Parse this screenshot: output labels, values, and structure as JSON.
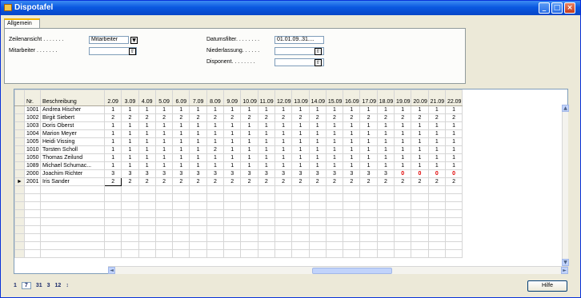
{
  "window": {
    "title": "Dispotafel",
    "controls": {
      "minimize": "_",
      "maximize": "□",
      "close": "×"
    }
  },
  "tabs": [
    {
      "label": "Allgemein"
    }
  ],
  "filters": {
    "zeilenansicht": {
      "label": "Zeilenansicht . . . . . . .",
      "value": "Mitarbeiter"
    },
    "mitarbeiter": {
      "label": "Mitarbeiter . . . . . . .",
      "value": ""
    },
    "datumsfilter": {
      "label": "Datumsfilter. . . . . . . .",
      "value": "01.01.09..31...."
    },
    "niederlassung": {
      "label": "Niederlassung. . . . . .",
      "value": ""
    },
    "disponent": {
      "label": "Disponent. . . . . . . .",
      "value": ""
    }
  },
  "grid": {
    "headers": {
      "nr": "Nr.",
      "beschreibung": "Beschreibung"
    },
    "days": [
      "2.09",
      "3.09",
      "4.09",
      "5.09",
      "6.09",
      "7.09",
      "8.09",
      "9.09",
      "10.09",
      "11.09",
      "12.09",
      "13.09",
      "14.09",
      "15.09",
      "16.09",
      "17.09",
      "18.09",
      "19.09",
      "20.09",
      "21.09",
      "22.09"
    ],
    "current_row_marker": "►",
    "rows": [
      {
        "nr": "1001",
        "name": "Andrea Hischer",
        "values": [
          "1",
          "1",
          "1",
          "1",
          "1",
          "1",
          "1",
          "1",
          "1",
          "1",
          "1",
          "1",
          "1",
          "1",
          "1",
          "1",
          "1",
          "1",
          "1",
          "1",
          "1"
        ]
      },
      {
        "nr": "1002",
        "name": "Birgit Siebert",
        "values": [
          "2",
          "2",
          "2",
          "2",
          "2",
          "2",
          "2",
          "2",
          "2",
          "2",
          "2",
          "2",
          "2",
          "2",
          "2",
          "2",
          "2",
          "2",
          "2",
          "2",
          "2"
        ]
      },
      {
        "nr": "1003",
        "name": "Doris Oberst",
        "values": [
          "1",
          "1",
          "1",
          "1",
          "1",
          "1",
          "1",
          "1",
          "1",
          "1",
          "1",
          "1",
          "1",
          "1",
          "1",
          "1",
          "1",
          "1",
          "1",
          "1",
          "1"
        ]
      },
      {
        "nr": "1004",
        "name": "Marion Meyer",
        "values": [
          "1",
          "1",
          "1",
          "1",
          "1",
          "1",
          "1",
          "1",
          "1",
          "1",
          "1",
          "1",
          "1",
          "1",
          "1",
          "1",
          "1",
          "1",
          "1",
          "1",
          "1"
        ]
      },
      {
        "nr": "1005",
        "name": "Heidi Vissing",
        "values": [
          "1",
          "1",
          "1",
          "1",
          "1",
          "1",
          "1",
          "1",
          "1",
          "1",
          "1",
          "1",
          "1",
          "1",
          "1",
          "1",
          "1",
          "1",
          "1",
          "1",
          "1"
        ]
      },
      {
        "nr": "1010",
        "name": "Torsten Scholl",
        "values": [
          "1",
          "1",
          "1",
          "1",
          "1",
          "1",
          "2",
          "1",
          "1",
          "1",
          "1",
          "1",
          "1",
          "1",
          "1",
          "1",
          "1",
          "1",
          "1",
          "1",
          "1"
        ]
      },
      {
        "nr": "1050",
        "name": "Thomas Zeilund",
        "values": [
          "1",
          "1",
          "1",
          "1",
          "1",
          "1",
          "1",
          "1",
          "1",
          "1",
          "1",
          "1",
          "1",
          "1",
          "1",
          "1",
          "1",
          "1",
          "1",
          "1",
          "1"
        ]
      },
      {
        "nr": "1089",
        "name": "Michael Schumac...",
        "values": [
          "1",
          "1",
          "1",
          "1",
          "1",
          "1",
          "1",
          "1",
          "1",
          "1",
          "1",
          "1",
          "1",
          "1",
          "1",
          "1",
          "1",
          "1",
          "1",
          "1",
          "1"
        ]
      },
      {
        "nr": "2000",
        "name": "Joachim Richter",
        "values": [
          "3",
          "3",
          "3",
          "3",
          "3",
          "3",
          "3",
          "3",
          "3",
          "3",
          "3",
          "3",
          "3",
          "3",
          "3",
          "3",
          "3",
          "0",
          "0",
          "0",
          "0"
        ],
        "red_from": 17
      },
      {
        "nr": "2001",
        "name": "Iris Sander",
        "values": [
          "2",
          "2",
          "2",
          "2",
          "2",
          "2",
          "2",
          "2",
          "2",
          "2",
          "2",
          "2",
          "2",
          "2",
          "2",
          "2",
          "2",
          "2",
          "2",
          "2",
          "2"
        ],
        "current": true
      }
    ],
    "empty_rows": 9
  },
  "pager": {
    "items": [
      "1",
      "7",
      "31",
      "3",
      "12",
      "↕"
    ],
    "active_index": 1
  },
  "help_button": "Hilfe",
  "colors": {
    "title_bar": "#0a58e0",
    "highlight_value": "#e00000",
    "panel": "#ece9d8"
  }
}
